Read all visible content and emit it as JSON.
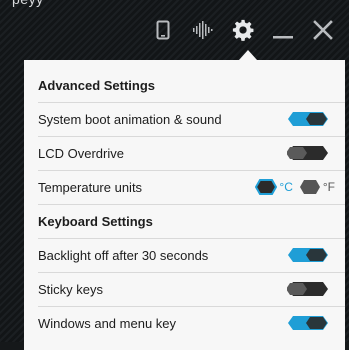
{
  "background": {
    "cut_text": "peyy"
  },
  "titlebar": {
    "buttons": [
      {
        "name": "device-icon"
      },
      {
        "name": "equalizer-icon"
      },
      {
        "name": "gear-icon"
      },
      {
        "name": "minimize-icon"
      },
      {
        "name": "close-icon"
      }
    ]
  },
  "colors": {
    "accent": "#1f9ed6",
    "off": "#2b2b2b",
    "panel": "#f7f7f7"
  },
  "advanced": {
    "title": "Advanced Settings",
    "boot_label": "System boot animation & sound",
    "boot_on": true,
    "lcd_label": "LCD Overdrive",
    "lcd_on": false,
    "temp_label": "Temperature units",
    "temp_c": "°C",
    "temp_f": "°F",
    "temp_selected": "C"
  },
  "keyboard": {
    "title": "Keyboard Settings",
    "backlight_label": "Backlight off after 30 seconds",
    "backlight_on": true,
    "sticky_label": "Sticky keys",
    "sticky_on": false,
    "winkey_label": "Windows and menu key",
    "winkey_on": true
  }
}
